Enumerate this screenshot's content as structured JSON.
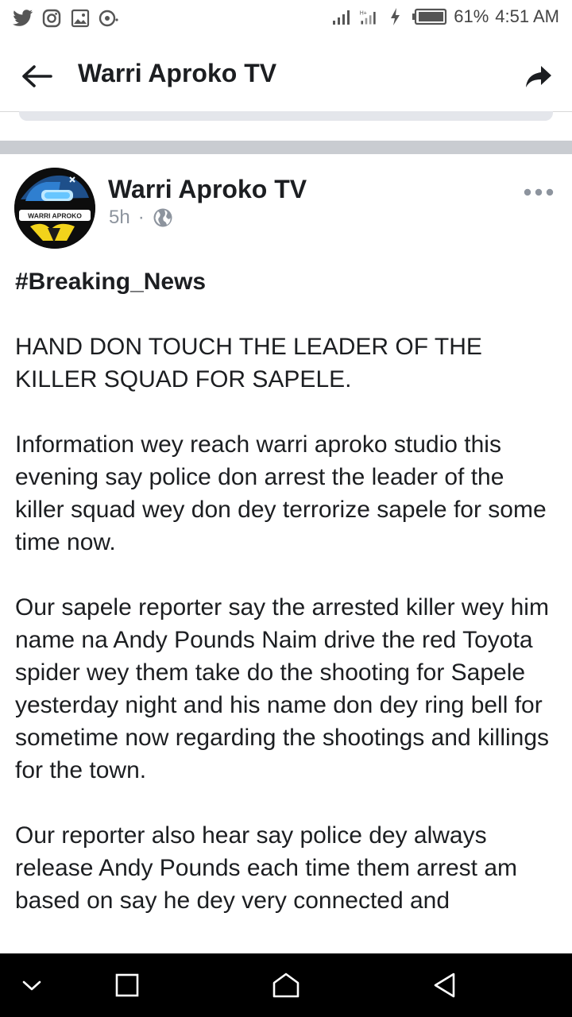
{
  "status_bar": {
    "left_icons": [
      "twitter-icon",
      "instagram-icon",
      "gallery-icon",
      "messenger-icon"
    ],
    "battery_percent": "61%",
    "time": "4:51 AM"
  },
  "app_bar": {
    "title": "Warri Aproko TV",
    "back_icon": "back-arrow-icon",
    "share_icon": "share-icon"
  },
  "post": {
    "author": "Warri Aproko TV",
    "avatar_label": "WARRI APROKO",
    "time": "5h",
    "separator": "·",
    "audience_icon": "globe-icon",
    "hashtag": "#Breaking_News",
    "paragraphs": [
      "HAND DON TOUCH THE LEADER OF THE KILLER SQUAD FOR SAPELE.",
      "Information wey reach warri aproko studio this evening say police don arrest the leader of the killer squad wey don dey terrorize sapele for some time now.",
      "Our sapele reporter say the arrested killer wey him name na Andy Pounds Naim drive the red Toyota spider wey them take do the shooting for Sapele yesterday night and his name don dey ring bell for sometime now regarding the shootings and killings for the town.",
      "Our reporter also hear say police dey always release Andy Pounds each time them arrest am based on say he dey very  connected and"
    ]
  },
  "nav_bar": {
    "buttons": [
      "chevron-down-icon",
      "recents-icon",
      "home-icon",
      "back-icon"
    ]
  },
  "colors": {
    "text_primary": "#1c1e21",
    "text_secondary": "#8d949e",
    "divider": "#c9ccd1",
    "nav_bg": "#000000"
  }
}
